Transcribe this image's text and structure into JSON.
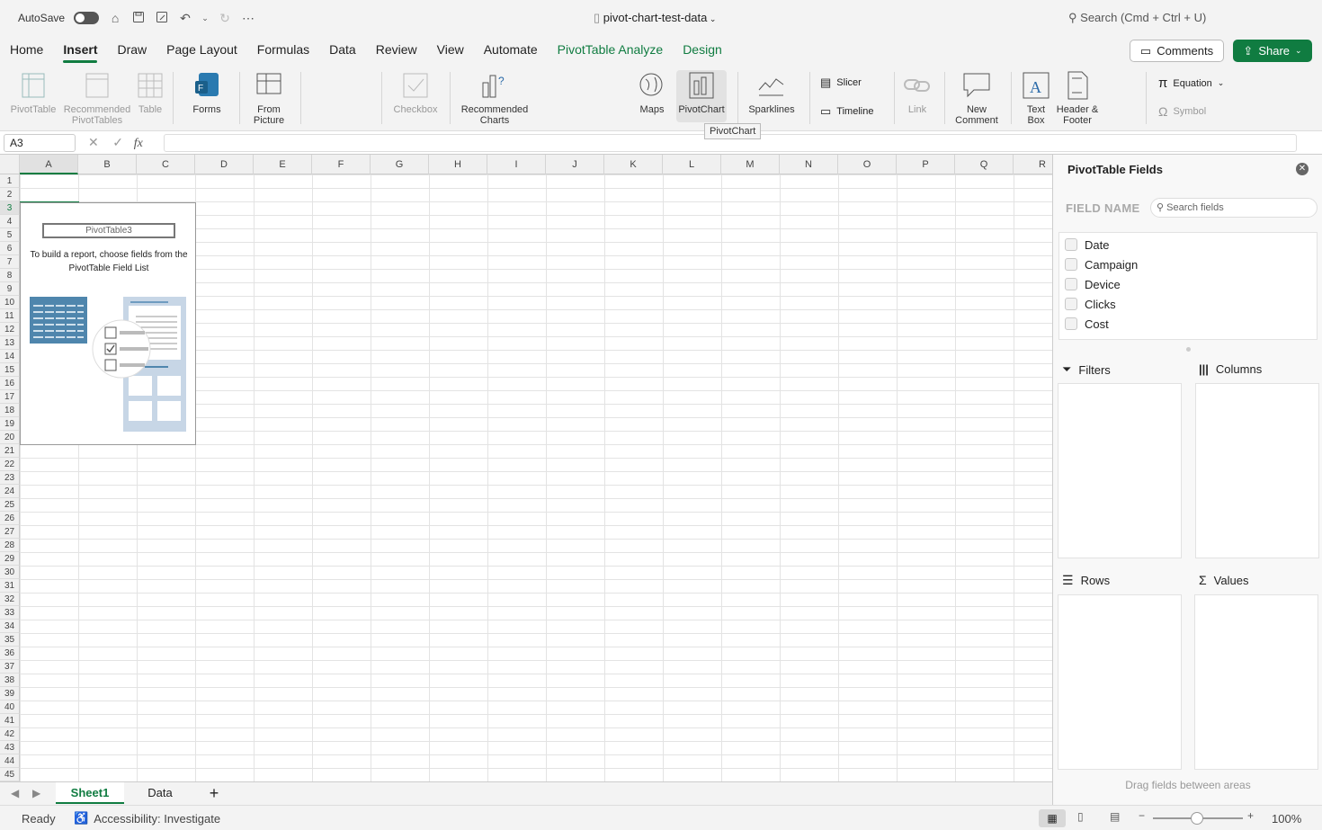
{
  "titlebar": {
    "autosave": "AutoSave",
    "doc_title": "pivot-chart-test-data",
    "search": "Search (Cmd + Ctrl + U)"
  },
  "menu": {
    "tabs": [
      "Home",
      "Insert",
      "Draw",
      "Page Layout",
      "Formulas",
      "Data",
      "Review",
      "View",
      "Automate",
      "PivotTable Analyze",
      "Design"
    ],
    "active": "Insert",
    "comments": "Comments",
    "share": "Share"
  },
  "ribbon": {
    "pivottable": "PivotTable",
    "recommended_pivottables": [
      "Recommended",
      "PivotTables"
    ],
    "table": "Table",
    "forms": "Forms",
    "from_picture": [
      "From",
      "Picture"
    ],
    "checkbox": "Checkbox",
    "recommended_charts": [
      "Recommended",
      "Charts"
    ],
    "maps": "Maps",
    "pivotchart": "PivotChart",
    "sparklines": "Sparklines",
    "slicer": "Slicer",
    "timeline": "Timeline",
    "link": "Link",
    "new_comment": [
      "New",
      "Comment"
    ],
    "text_box": [
      "Text",
      "Box"
    ],
    "header_footer": [
      "Header &",
      "Footer"
    ],
    "equation": "Equation",
    "symbol": "Symbol",
    "tooltip": "PivotChart"
  },
  "formula_bar": {
    "name_box": "A3",
    "fx": "fx",
    "formula": ""
  },
  "grid": {
    "columns": [
      "A",
      "B",
      "C",
      "D",
      "E",
      "F",
      "G",
      "H",
      "I",
      "J",
      "K",
      "L",
      "M",
      "N",
      "O",
      "P",
      "Q",
      "R"
    ],
    "rows": [
      "1",
      "2",
      "3",
      "4",
      "5",
      "6",
      "7",
      "8",
      "9",
      "10",
      "11",
      "12",
      "13",
      "14",
      "15",
      "16",
      "17",
      "18",
      "19",
      "20",
      "21",
      "22",
      "23",
      "24",
      "25",
      "26",
      "27",
      "28",
      "29",
      "30",
      "31",
      "32",
      "33",
      "34",
      "35",
      "36",
      "37",
      "38",
      "39",
      "40",
      "41",
      "42",
      "43",
      "44",
      "45"
    ],
    "selected_cell": "A3"
  },
  "pivot_placeholder": {
    "name": "PivotTable3",
    "message_line1": "To build a report, choose fields from the",
    "message_line2": "PivotTable Field List"
  },
  "sheets": {
    "tabs": [
      "Sheet1",
      "Data"
    ],
    "active": "Sheet1",
    "add": "+"
  },
  "status": {
    "ready": "Ready",
    "accessibility": "Accessibility: Investigate",
    "zoom": "100%"
  },
  "panel": {
    "title": "PivotTable Fields",
    "field_name": "FIELD NAME",
    "search_placeholder": "Search fields",
    "fields": [
      "Date",
      "Campaign",
      "Device",
      "Clicks",
      "Cost"
    ],
    "areas": {
      "filters": "Filters",
      "columns": "Columns",
      "rows": "Rows",
      "values": "Values"
    },
    "hint": "Drag fields between areas"
  },
  "colors": {
    "accent": "#107c41",
    "pivot_blue": "#5a8fb0"
  }
}
